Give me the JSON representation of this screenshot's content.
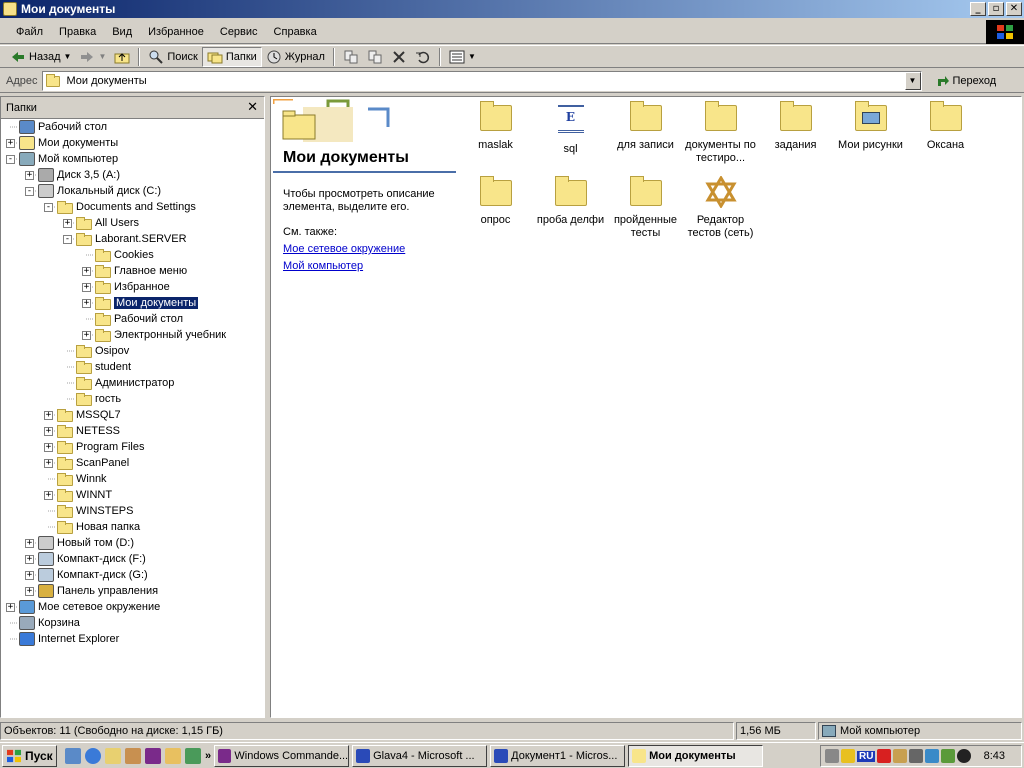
{
  "window": {
    "title": "Мои документы"
  },
  "menu": [
    "Файл",
    "Правка",
    "Вид",
    "Избранное",
    "Сервис",
    "Справка"
  ],
  "toolbar": {
    "back": "Назад",
    "search": "Поиск",
    "folders": "Папки",
    "history": "Журнал"
  },
  "address": {
    "label": "Адрес",
    "value": "Мои документы",
    "go": "Переход"
  },
  "folders_pane": {
    "title": "Папки",
    "items": [
      {
        "label": "Рабочий стол",
        "expander": "none",
        "icon": "desktop-icon"
      },
      {
        "label": "Мои документы",
        "expander": "+",
        "icon": "my-documents-icon"
      },
      {
        "label": "Мой компьютер",
        "expander": "-",
        "icon": "my-computer-icon"
      },
      {
        "label": "Диск 3,5 (A:)",
        "expander": "+",
        "icon": "floppy-icon"
      },
      {
        "label": "Локальный диск (C:)",
        "expander": "-",
        "icon": "hard-drive-icon"
      },
      {
        "label": "Documents and Settings",
        "expander": "-",
        "icon": "folder-icon"
      },
      {
        "label": "All Users",
        "expander": "+",
        "icon": "folder-icon"
      },
      {
        "label": "Laborant.SERVER",
        "expander": "-",
        "icon": "folder-icon"
      },
      {
        "label": "Cookies",
        "expander": "none",
        "icon": "folder-icon"
      },
      {
        "label": "Главное меню",
        "expander": "+",
        "icon": "folder-icon"
      },
      {
        "label": "Избранное",
        "expander": "+",
        "icon": "favorites-folder-icon"
      },
      {
        "label": "Мои документы",
        "expander": "+",
        "icon": "folder-icon",
        "selected": true
      },
      {
        "label": "Рабочий стол",
        "expander": "none",
        "icon": "folder-icon"
      },
      {
        "label": "Электронный учебник",
        "expander": "+",
        "icon": "folder-icon"
      },
      {
        "label": "Osipov",
        "expander": "none",
        "icon": "folder-icon"
      },
      {
        "label": "student",
        "expander": "none",
        "icon": "folder-icon"
      },
      {
        "label": "Администратор",
        "expander": "none",
        "icon": "folder-icon"
      },
      {
        "label": "гость",
        "expander": "none",
        "icon": "folder-icon"
      },
      {
        "label": "MSSQL7",
        "expander": "+",
        "icon": "folder-icon"
      },
      {
        "label": "NETESS",
        "expander": "+",
        "icon": "folder-icon"
      },
      {
        "label": "Program Files",
        "expander": "+",
        "icon": "folder-icon"
      },
      {
        "label": "ScanPanel",
        "expander": "+",
        "icon": "folder-icon"
      },
      {
        "label": "Winnk",
        "expander": "none",
        "icon": "folder-icon"
      },
      {
        "label": "WINNT",
        "expander": "+",
        "icon": "folder-icon"
      },
      {
        "label": "WINSTEPS",
        "expander": "none",
        "icon": "folder-icon"
      },
      {
        "label": "Новая папка",
        "expander": "none",
        "icon": "folder-icon"
      },
      {
        "label": "Новый том (D:)",
        "expander": "+",
        "icon": "hard-drive-icon"
      },
      {
        "label": "Компакт-диск (F:)",
        "expander": "+",
        "icon": "cd-drive-icon"
      },
      {
        "label": "Компакт-диск (G:)",
        "expander": "+",
        "icon": "cd-drive-icon"
      },
      {
        "label": "Панель управления",
        "expander": "+",
        "icon": "control-panel-icon"
      },
      {
        "label": "Мое сетевое окружение",
        "expander": "+",
        "icon": "network-icon"
      },
      {
        "label": "Корзина",
        "expander": "none",
        "icon": "recycle-bin-icon"
      },
      {
        "label": "Internet Explorer",
        "expander": "none",
        "icon": "internet-explorer-icon"
      }
    ]
  },
  "info_panel": {
    "title": "Мои документы",
    "desc": "Чтобы просмотреть описание элемента, выделите его.",
    "see_also": "См. также:",
    "links": [
      "Мое сетевое окружение",
      "Мой компьютер"
    ]
  },
  "files": [
    {
      "label": "maslak",
      "icon": "folder-icon"
    },
    {
      "label": "sql",
      "icon": "document-icon"
    },
    {
      "label": "для записи",
      "icon": "folder-icon"
    },
    {
      "label": "документы по тестиро...",
      "icon": "folder-icon"
    },
    {
      "label": "задания",
      "icon": "folder-icon"
    },
    {
      "label": "Мои рисунки",
      "icon": "pictures-folder-icon"
    },
    {
      "label": "Оксана",
      "icon": "folder-icon"
    },
    {
      "label": "опрос",
      "icon": "folder-icon"
    },
    {
      "label": "проба делфи",
      "icon": "folder-icon"
    },
    {
      "label": "пройденные тесты",
      "icon": "folder-icon"
    },
    {
      "label": "Редактор тестов (сеть)",
      "icon": "star-of-david-icon"
    }
  ],
  "status": {
    "objects": "Объектов: 11 (Свободно на диске: 1,15 ГБ)",
    "size": "1,56 МБ",
    "location": "Мой компьютер"
  },
  "taskbar": {
    "start": "Пуск",
    "tasks": [
      "Windows Commande...",
      "Glava4 - Microsoft ...",
      "Документ1 - Micros...",
      "Мои документы"
    ],
    "lang": "RU",
    "clock": "8:43"
  }
}
